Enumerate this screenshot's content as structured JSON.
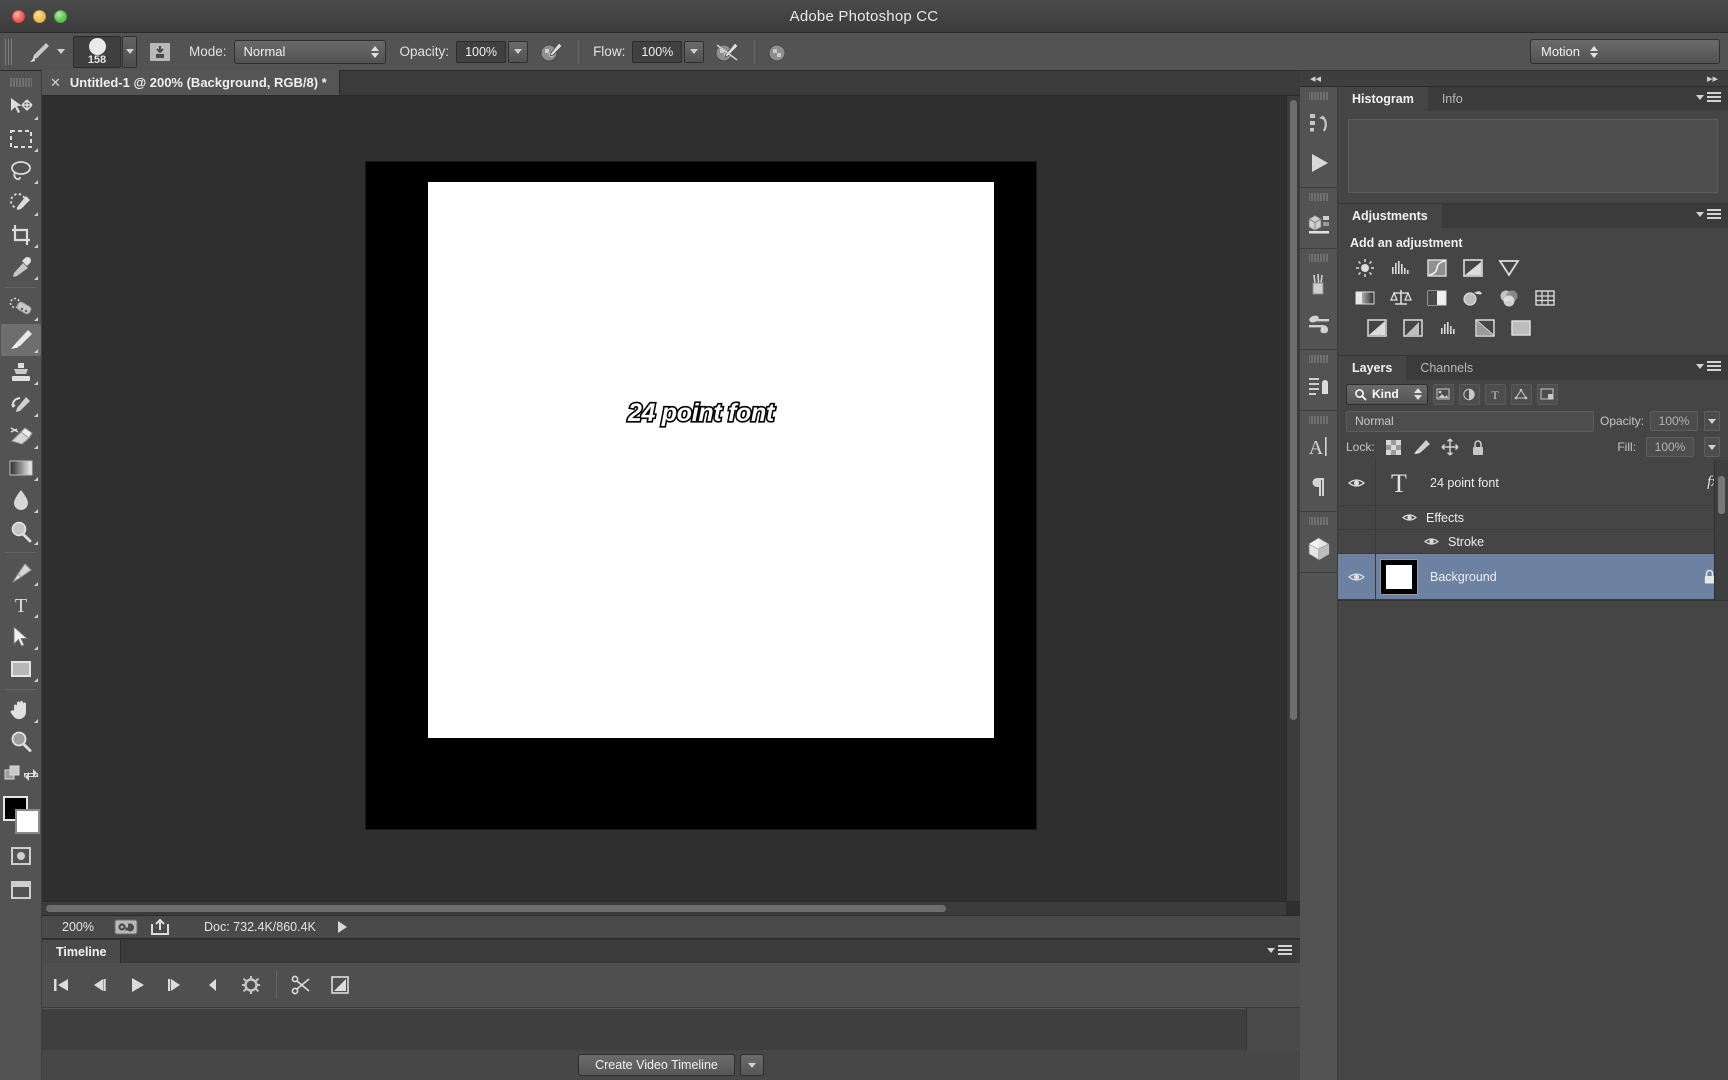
{
  "window": {
    "title": "Adobe Photoshop CC"
  },
  "options_bar": {
    "brush_size": "158",
    "mode_label": "Mode:",
    "mode_value": "Normal",
    "opacity_label": "Opacity:",
    "opacity_value": "100%",
    "flow_label": "Flow:",
    "flow_value": "100%",
    "workspace_value": "Motion",
    "icons": {
      "brush_preset_picker": "brush-preset-icon",
      "brush_panel": "brush-panel-icon",
      "airbrush": "airbrush-icon",
      "tablet_pressure_opacity": "tablet-pressure-opacity-icon",
      "tablet_pressure_size": "tablet-pressure-size-icon"
    }
  },
  "toolbar": {
    "tools": [
      {
        "name": "move-tool",
        "selected": false
      },
      {
        "name": "rectangular-marquee-tool",
        "selected": false
      },
      {
        "name": "lasso-tool",
        "selected": false
      },
      {
        "name": "quick-selection-tool",
        "selected": false
      },
      {
        "name": "crop-tool",
        "selected": false
      },
      {
        "name": "eyedropper-tool",
        "selected": false
      },
      {
        "name": "spot-healing-brush-tool",
        "selected": false
      },
      {
        "name": "brush-tool",
        "selected": true
      },
      {
        "name": "clone-stamp-tool",
        "selected": false
      },
      {
        "name": "history-brush-tool",
        "selected": false
      },
      {
        "name": "eraser-tool",
        "selected": false
      },
      {
        "name": "gradient-tool",
        "selected": false
      },
      {
        "name": "blur-tool",
        "selected": false
      },
      {
        "name": "dodge-tool",
        "selected": false
      },
      {
        "name": "pen-tool",
        "selected": false
      },
      {
        "name": "horizontal-type-tool",
        "selected": false
      },
      {
        "name": "path-selection-tool",
        "selected": false
      },
      {
        "name": "rectangle-tool",
        "selected": false
      },
      {
        "name": "hand-tool",
        "selected": false
      },
      {
        "name": "zoom-tool",
        "selected": false
      }
    ],
    "foreground_color": "#000000",
    "background_color": "#ffffff"
  },
  "document": {
    "tab_title": "Untitled-1 @ 200% (Background, RGB/8) *",
    "canvas_text": "24 point font"
  },
  "status_bar": {
    "zoom": "200%",
    "doc_info": "Doc: 732.4K/860.4K"
  },
  "timeline": {
    "tab_label": "Timeline",
    "create_button": "Create Video Timeline",
    "controls": [
      "go-to-first-frame-icon",
      "previous-frame-icon",
      "play-icon",
      "next-frame-icon",
      "audio-mute-icon",
      "settings-gear-icon",
      "split-at-playhead-icon",
      "transition-icon"
    ]
  },
  "icon_rail": {
    "groups": [
      [
        "history-icon",
        "actions-play-icon"
      ],
      [
        "3d-materials-icon"
      ],
      [
        "brush-presets-icon",
        "tool-presets-icon"
      ],
      [
        "layer-comps-icon"
      ],
      [
        "character-icon",
        "paragraph-icon"
      ],
      [
        "3d-panel-icon"
      ]
    ]
  },
  "panels": {
    "histogram": {
      "tabs": [
        {
          "label": "Histogram",
          "active": true
        },
        {
          "label": "Info",
          "active": false
        }
      ]
    },
    "adjustments": {
      "tabs": [
        {
          "label": "Adjustments",
          "active": true
        }
      ],
      "subtitle": "Add an adjustment",
      "icons": [
        [
          "brightness-contrast-icon",
          "levels-icon",
          "curves-icon",
          "exposure-icon",
          "vibrance-icon"
        ],
        [
          "hue-saturation-icon",
          "color-balance-icon",
          "black-white-icon",
          "photo-filter-icon",
          "channel-mixer-icon",
          "color-lookup-icon"
        ],
        [
          "invert-icon",
          "posterize-icon",
          "threshold-icon",
          "gradient-map-icon",
          "selective-color-icon"
        ]
      ]
    },
    "layers": {
      "tabs": [
        {
          "label": "Layers",
          "active": true
        },
        {
          "label": "Channels",
          "active": false
        }
      ],
      "filter_kind": "Kind",
      "filter_icons": [
        "filter-pixel-icon",
        "filter-adjustment-icon",
        "filter-type-icon",
        "filter-shape-icon",
        "filter-smart-object-icon"
      ],
      "blend_mode": "Normal",
      "opacity_label": "Opacity:",
      "opacity_value": "100%",
      "lock_label": "Lock:",
      "lock_icons": [
        "lock-transparent-pixels-icon",
        "lock-image-pixels-icon",
        "lock-position-icon",
        "lock-all-icon"
      ],
      "fill_label": "Fill:",
      "fill_value": "100%",
      "rows": [
        {
          "name": "24 point font",
          "type": "type-layer",
          "visible": true,
          "selected": false,
          "has_fx": true,
          "fx_badge": "fx",
          "locked": false
        },
        {
          "name": "Effects",
          "type": "effects-group",
          "visible": true,
          "indent": 1
        },
        {
          "name": "Stroke",
          "type": "layer-effect",
          "visible": true,
          "indent": 2
        },
        {
          "name": "Background",
          "type": "image-layer",
          "visible": true,
          "selected": true,
          "has_fx": false,
          "locked": true
        }
      ]
    }
  },
  "colors": {
    "selection_blue": "#6d82a3",
    "panel_bg": "#454545",
    "chrome_bg": "#535353",
    "canvas_bg": "#2f2f2f"
  }
}
